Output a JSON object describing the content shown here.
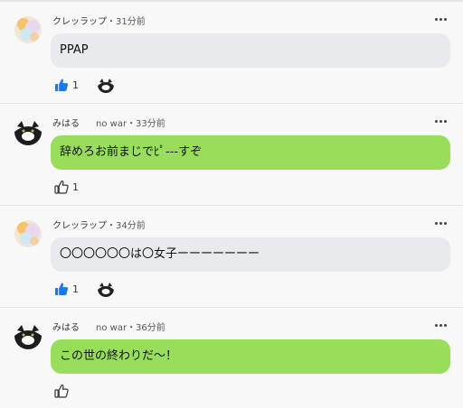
{
  "comments": [
    {
      "user": "クレッラップ",
      "meta": "・31分前",
      "text": "PPAP",
      "likes": "1",
      "liked": true,
      "has_reactor": true,
      "style": "gray",
      "avatar": "pastel-avatar"
    },
    {
      "user": "みはる",
      "subtitle": "no war",
      "meta": "・33分前",
      "text": "辞めろお前まじでﾋﾟ---すぞ",
      "likes": "1",
      "liked": false,
      "has_reactor": false,
      "style": "green",
      "avatar": "cat-avatar"
    },
    {
      "user": "クレッラップ",
      "meta": "・34分前",
      "text": "〇〇〇〇〇〇は〇女子ーーーーーーー",
      "likes": "1",
      "liked": true,
      "has_reactor": true,
      "style": "gray",
      "avatar": "pastel-avatar"
    },
    {
      "user": "みはる",
      "subtitle": "no war",
      "meta": "・36分前",
      "text": "この世の終わりだ〜！",
      "likes": "",
      "liked": false,
      "has_reactor": false,
      "style": "green",
      "avatar": "cat-avatar"
    }
  ],
  "colors": {
    "bubble_gray": "#e9eaed",
    "bubble_green": "#98de5a",
    "like_active": "#1877f2"
  },
  "icons": {
    "like": "thumbs-up-icon",
    "more": "more-options-icon"
  }
}
